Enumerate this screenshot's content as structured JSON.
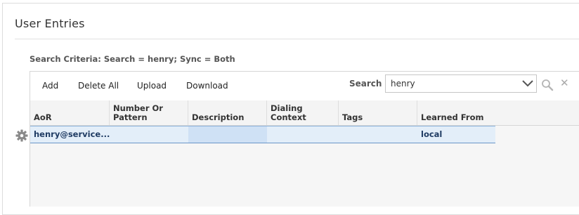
{
  "page": {
    "title": "User Entries",
    "criteria": "Search Criteria: Search = henry; Sync = Both"
  },
  "toolbar": {
    "add_label": "Add",
    "delete_all_label": "Delete All",
    "upload_label": "Upload",
    "download_label": "Download",
    "search_label": "Search",
    "search_value": "henry"
  },
  "table": {
    "columns": [
      "AoR",
      "Number Or Pattern",
      "Description",
      "Dialing Context",
      "Tags",
      "Learned From"
    ],
    "rows": [
      {
        "aor": "henry@service...",
        "number_or_pattern": "",
        "description": "",
        "dialing_context": "",
        "tags": "",
        "learned_from": "local"
      }
    ]
  },
  "icons": {
    "row_menu": "gear-icon",
    "search": "search-icon",
    "clear": "close-icon",
    "dropdown": "chevron-down-icon"
  },
  "colors": {
    "selected_row": "#e3eef9",
    "selected_row_border": "#6a95c8",
    "row_text": "#1f3b63"
  }
}
